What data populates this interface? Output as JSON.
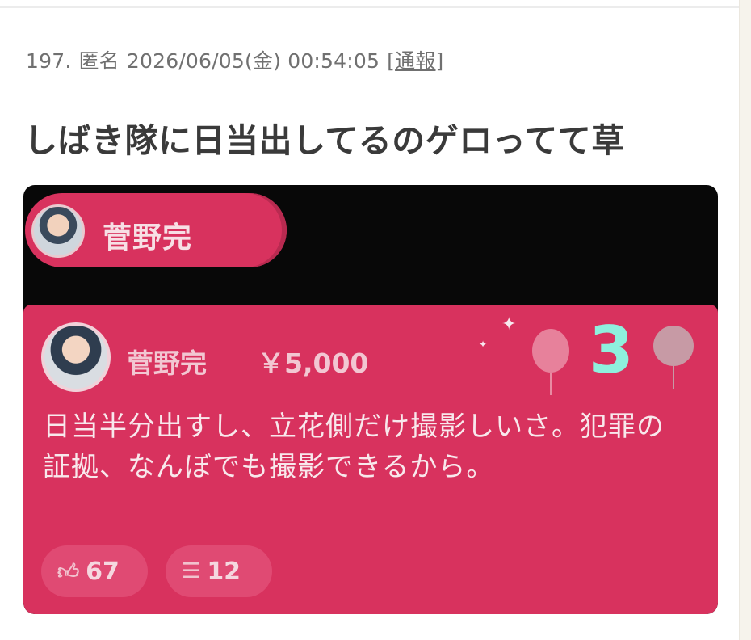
{
  "post": {
    "number": "197.",
    "author": "匿名",
    "datetime": "2026/06/05(金) 00:54:05",
    "report_prefix": "[",
    "report_label": "通報",
    "report_suffix": "]",
    "title": "しばき隊に日当出してるのゲロってて草"
  },
  "screenshot": {
    "pill_name": "菅野完",
    "card": {
      "name": "菅野完",
      "amount": "￥5,000",
      "badge": "3",
      "message": "日当半分出すし、立花側だけ撮影しいさ。犯罪の証拠、なんぼでも撮影できるから。",
      "likes": "67",
      "replies": "12"
    }
  },
  "icons": {
    "like": "thumbs-up-icon",
    "reply": "reply-icon"
  },
  "colors": {
    "card_bg": "#d8325e",
    "title": "#3a3a3a",
    "meta": "#707070",
    "badge": "#8ef0dd"
  }
}
